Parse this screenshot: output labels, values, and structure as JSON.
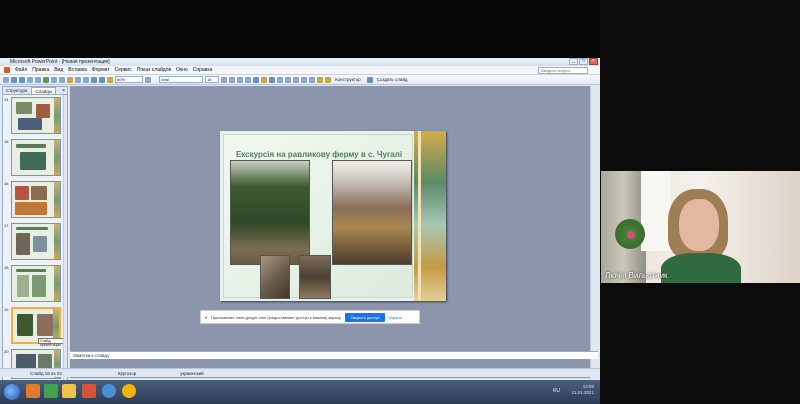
{
  "window": {
    "title": "Microsoft PowerPoint - [Новая презентация]",
    "menu": [
      "Файл",
      "Правка",
      "Вид",
      "Вставка",
      "Формат",
      "Сервис",
      "Показ слайдов",
      "Окно",
      "Справка"
    ],
    "help_placeholder": "Введите вопрос",
    "zoom": "60%",
    "font": "Arial",
    "font_size": "18",
    "toolbar_labels": [
      "Конструктор",
      "Создать слайд"
    ]
  },
  "left_pane": {
    "tabs": [
      "Структура",
      "Слайды"
    ],
    "close": "×",
    "slides": [
      {
        "num": "14"
      },
      {
        "num": "15"
      },
      {
        "num": "16"
      },
      {
        "num": "17"
      },
      {
        "num": "18"
      },
      {
        "num": "19"
      },
      {
        "num": "20"
      }
    ],
    "tooltip": "Слайд презентации"
  },
  "slide": {
    "title": "Екскурсія на равликову ферму в с. Чугалі"
  },
  "notes_placeholder": "Заметки к слайду",
  "status": {
    "slide_of": "Слайд 19 из 22",
    "design": "Кругозор",
    "language": "украинский"
  },
  "notification": {
    "text": "Приложение meet.google.com предоставляет доступ к вашему экрану.",
    "stop_button": "Закрыть доступ",
    "hide": "Скрыть"
  },
  "taskbar": {
    "tray_time": "13:03",
    "tray_date": "21.01.2021",
    "tray_lang": "RU"
  },
  "video": {
    "participant_name": "Лючія Вильотник"
  },
  "colors": {
    "slide_title": "#4f7f62",
    "selection": "#f0b23a",
    "taskbar": "#2c3c55"
  }
}
